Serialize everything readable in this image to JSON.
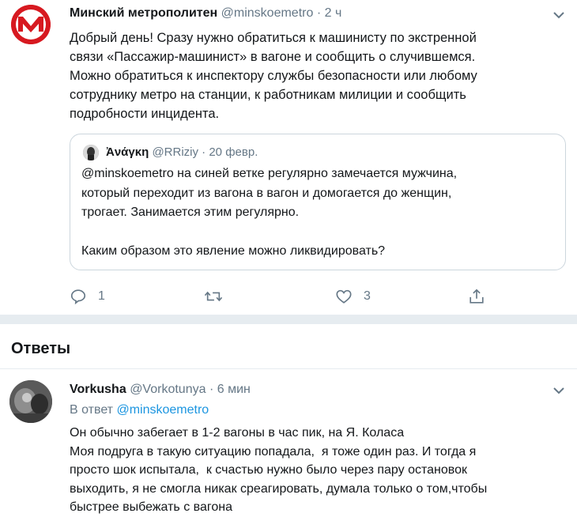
{
  "main_tweet": {
    "name": "Минский метрополитен",
    "handle": "@minskoemetro",
    "separator": "·",
    "time": "2 ч",
    "text": "Добрый день! Сразу нужно обратиться к машинисту по экстренной\nсвязи «Пассажир-машинист» в вагоне и сообщить о случившемся.\nМожно обратиться к инспектору службы безопасности или любому\nсотруднику метро на станции, к работникам милиции и сообщить\nподробности инцидента.",
    "quote": {
      "name": "Ἀνάγκη",
      "handle": "@RRiziy",
      "separator": "·",
      "date": "20 февр.",
      "text": "@minskoemetro на синей ветке регулярно замечается мужчина,\nкоторый переходит из вагона в вагон и домогается до женщин,\nтрогает. Занимается этим регулярно.\n\nКаким образом это явление можно ликвидировать?"
    },
    "actions": {
      "reply_count": "1",
      "retweet_count": "",
      "like_count": "3"
    }
  },
  "replies_section": {
    "title": "Ответы"
  },
  "reply": {
    "name": "Vorkusha",
    "handle": "@Vorkotunya",
    "separator": "·",
    "time": "6 мин",
    "in_reply_prefix": "В ответ",
    "in_reply_handle": "@minskoemetro",
    "text": "Он обычно забегает в 1-2 вагоны в час пик, на Я. Коласа\nМоя подруга в такую ситуацию попадала,  я тоже один раз. И тогда я\nпросто шок испытала,  к счастью нужно было через пару остановок\nвыходить, я не смогла никак среагировать, думала только о том,чтобы\nбыстрее выбежать с вагона"
  },
  "icons": {
    "metro_logo": "metro-m-logo",
    "caret": "chevron-down-icon",
    "reply": "reply-icon",
    "retweet": "retweet-icon",
    "like": "heart-icon",
    "share": "share-icon"
  },
  "colors": {
    "brand_red": "#d71920",
    "secondary_text": "#657786",
    "link": "#1b95e0",
    "divider": "#e6ecf0",
    "border": "#ccd6dd"
  }
}
